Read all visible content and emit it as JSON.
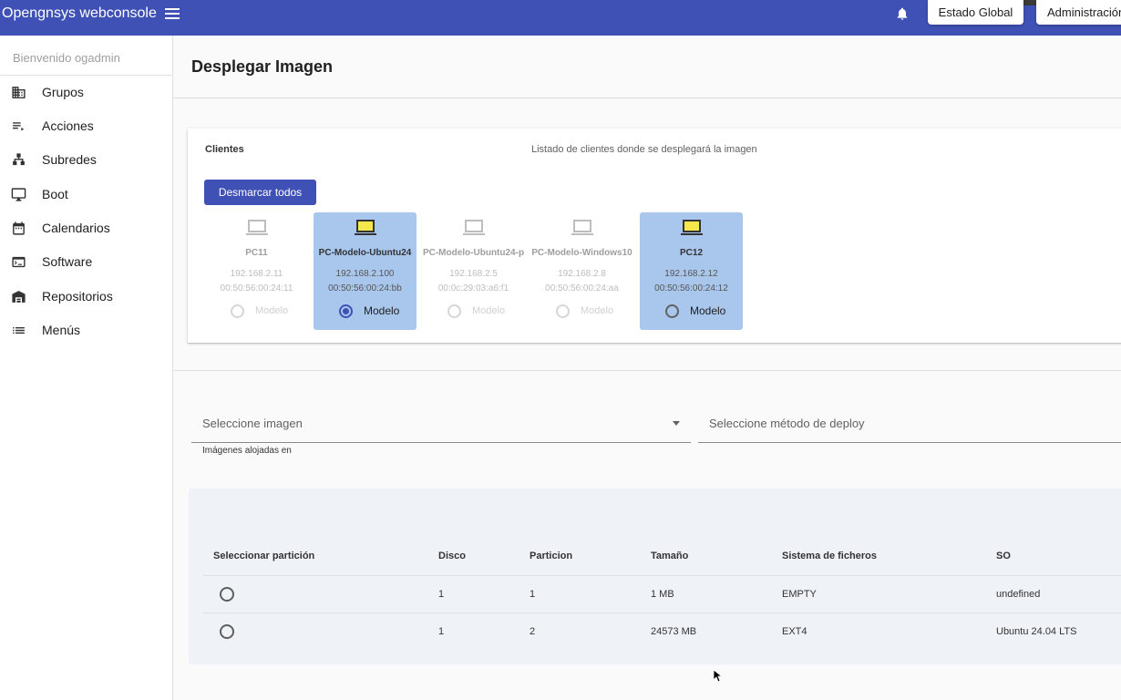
{
  "header": {
    "app_title": "Opengnsys webconsole",
    "btn_global": "Estado Global",
    "btn_admin": "Administración"
  },
  "sidebar": {
    "welcome": "Bienvenido ogadmin",
    "items": [
      {
        "label": "Grupos",
        "icon": "buildings-icon"
      },
      {
        "label": "Acciones",
        "icon": "list-icon"
      },
      {
        "label": "Subredes",
        "icon": "network-icon"
      },
      {
        "label": "Boot",
        "icon": "monitor-icon"
      },
      {
        "label": "Calendarios",
        "icon": "calendar-icon"
      },
      {
        "label": "Software",
        "icon": "terminal-icon"
      },
      {
        "label": "Repositorios",
        "icon": "warehouse-icon"
      },
      {
        "label": "Menús",
        "icon": "menu-list-icon"
      }
    ]
  },
  "page": {
    "title": "Desplegar Imagen"
  },
  "clients_card": {
    "label": "Clientes",
    "description": "Listado de clientes donde se desplegará la imagen",
    "unmark_all": "Desmarcar todos",
    "clients": [
      {
        "name": "PC11",
        "ip": "192.168.2.11",
        "mac": "00:50:56:00:24:11",
        "radio_label": "Modelo",
        "selected": false,
        "model": false
      },
      {
        "name": "PC-Modelo-Ubuntu24",
        "ip": "192.168.2.100",
        "mac": "00:50:56:00:24:bb",
        "radio_label": "Modelo",
        "selected": true,
        "model": true
      },
      {
        "name": "PC-Modelo-Ubuntu24-p",
        "ip": "192.168.2.5",
        "mac": "00:0c:29:03:a6:f1",
        "radio_label": "Modelo",
        "selected": false,
        "model": false
      },
      {
        "name": "PC-Modelo-Windows10",
        "ip": "192.168.2.8",
        "mac": "00:50:56:00:24:aa",
        "radio_label": "Modelo",
        "selected": false,
        "model": false
      },
      {
        "name": "PC12",
        "ip": "192.168.2.12",
        "mac": "00:50:56:00:24:12",
        "radio_label": "Modelo",
        "selected": true,
        "model": false
      }
    ]
  },
  "form": {
    "image_placeholder": "Seleccione imagen",
    "deploy_placeholder": "Seleccione método de deploy",
    "hint": "Imágenes alojadas en"
  },
  "partitions": {
    "headers": [
      "Seleccionar partición",
      "Disco",
      "Particion",
      "Tamaño",
      "Sistema de ficheros",
      "SO"
    ],
    "rows": [
      {
        "disk": "1",
        "partition": "1",
        "size": "1 MB",
        "filesystem": "EMPTY",
        "os": "undefined"
      },
      {
        "disk": "1",
        "partition": "2",
        "size": "24573 MB",
        "filesystem": "EXT4",
        "os": "Ubuntu 24.04 LTS"
      }
    ]
  },
  "colors": {
    "primary": "#3f51b5",
    "selected_card": "#a9c6ec",
    "pc_active": "#f5e84a"
  }
}
